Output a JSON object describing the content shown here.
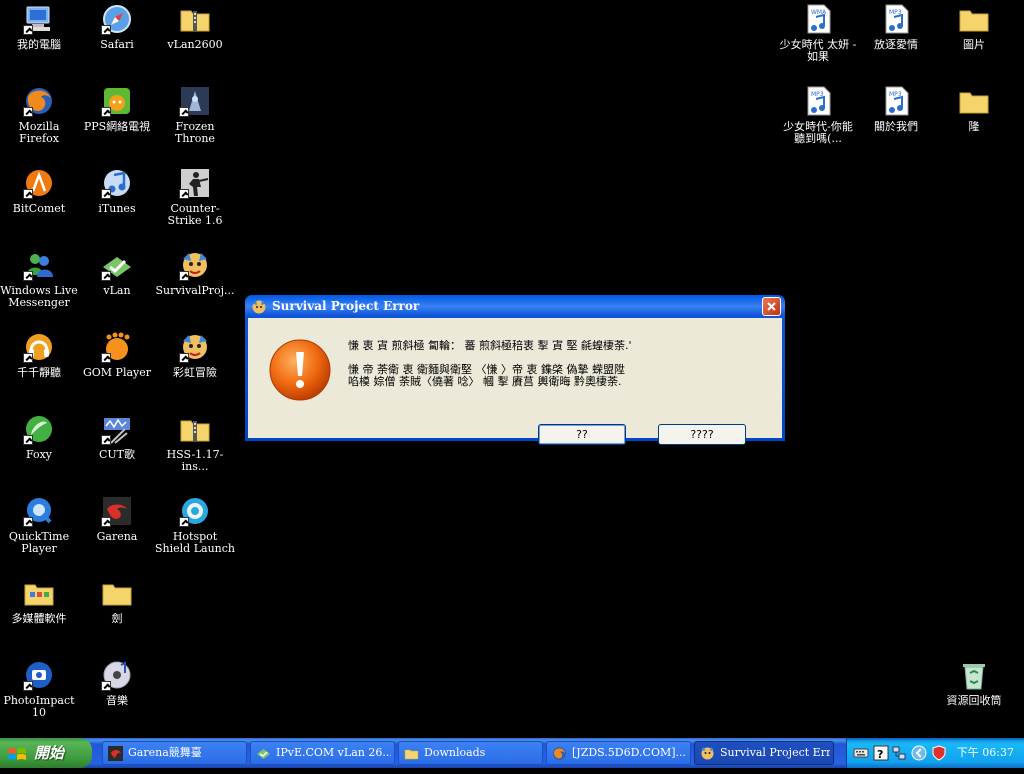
{
  "desktop": {
    "icons": [
      {
        "label": "我的電腦",
        "icon": "computer-icon"
      },
      {
        "label": "Safari",
        "icon": "compass-icon"
      },
      {
        "label": "vLan2600",
        "icon": "zip-folder-icon"
      },
      {
        "label": "Mozilla Firefox",
        "icon": "firefox-icon"
      },
      {
        "label": "PPS網絡電視",
        "icon": "pps-icon"
      },
      {
        "label": "Frozen Throne",
        "icon": "warcraft-icon"
      },
      {
        "label": "BitComet",
        "icon": "bitcomet-icon"
      },
      {
        "label": "iTunes",
        "icon": "music-note-icon"
      },
      {
        "label": "Counter-Strike 1.6",
        "icon": "counter-strike-icon"
      },
      {
        "label": "Windows Live Messenger",
        "icon": "messenger-icon"
      },
      {
        "label": "vLan",
        "icon": "vlan-icon"
      },
      {
        "label": "SurvivalProj...",
        "icon": "survival-project-icon"
      },
      {
        "label": "千千靜聽",
        "icon": "headphones-icon"
      },
      {
        "label": "GOM Player",
        "icon": "gom-icon"
      },
      {
        "label": "彩虹冒險",
        "icon": "survival-project-icon"
      },
      {
        "label": "Foxy",
        "icon": "foxy-icon"
      },
      {
        "label": "CUT歌",
        "icon": "audio-cutter-icon"
      },
      {
        "label": "HSS-1.17-ins...",
        "icon": "zip-folder-icon"
      },
      {
        "label": "QuickTime Player",
        "icon": "quicktime-icon"
      },
      {
        "label": "Garena",
        "icon": "garena-icon"
      },
      {
        "label": "Hotspot Shield Launch",
        "icon": "shield-icon"
      },
      {
        "label": "多媒體軟件",
        "icon": "folder-icon"
      },
      {
        "label": "劍",
        "icon": "folder-icon"
      },
      {
        "label": "PhotoImpact 10",
        "icon": "photoimpact-icon"
      },
      {
        "label": "音樂",
        "icon": "cd-icon"
      },
      {
        "label": "少女時代 太妍 - 如果",
        "icon": "wma-file-icon"
      },
      {
        "label": "放逐愛情",
        "icon": "mp3-file-icon"
      },
      {
        "label": "圖片",
        "icon": "folder-icon"
      },
      {
        "label": "少女時代-你能聽到嗎(...",
        "icon": "mp3-file-icon"
      },
      {
        "label": "關於我們",
        "icon": "mp3-file-icon"
      },
      {
        "label": "隆",
        "icon": "folder-icon"
      },
      {
        "label": "資源回收筒",
        "icon": "recycle-bin-icon"
      }
    ]
  },
  "dialog": {
    "title": "Survival Project Error",
    "message_line1": "慊   衷   寊       煎斜極 匐輪：   蕃    煎斜極稖衷   揧 寊      堅 毹蝗棲荼.'",
    "message_line2": "慊   帝 荼衛 衷    衛麵與衛堅  〈慊   〉帝 衷          鏶棨 偽摯 蝾盟陞",
    "message_line3": "啗橂 婃僧    荼賊〈僥著   唸〉 幗   揧 賡莒     輿衛晦 黔奧棲荼.",
    "button1": "??",
    "button2": "????"
  },
  "taskbar": {
    "start_label": "開始",
    "tasks": [
      {
        "label": "Garena競舞臺",
        "icon": "garena-icon"
      },
      {
        "label": "IPvE.COM vLan 26...",
        "icon": "vlan-icon"
      },
      {
        "label": "Downloads",
        "icon": "folder-icon"
      },
      {
        "label": "[JZDS.5D6D.COM]...",
        "icon": "firefox-icon"
      },
      {
        "label": "Survival Project Error",
        "icon": "survival-project-icon"
      }
    ],
    "clock": "下午 06:37"
  }
}
